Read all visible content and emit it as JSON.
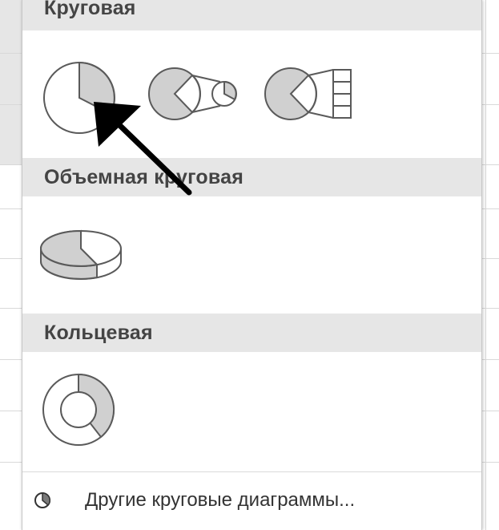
{
  "menu": {
    "sections": [
      {
        "title": "Круговая"
      },
      {
        "title": "Объемная круговая"
      },
      {
        "title": "Кольцевая"
      }
    ],
    "footer_label": "Другие круговые диаграммы..."
  },
  "icons": {
    "pie": "pie-chart-icon",
    "pie_of_pie": "pie-of-pie-chart-icon",
    "bar_of_pie": "bar-of-pie-chart-icon",
    "pie_3d": "3d-pie-chart-icon",
    "doughnut": "doughnut-chart-icon",
    "more": "pie-small-icon",
    "annotation": "arrow-annotation"
  },
  "colors": {
    "header_bg": "#e6e6e6",
    "slice_fill": "#d0d0d0",
    "outline": "#5a5a5a",
    "annotation": "#000000"
  }
}
